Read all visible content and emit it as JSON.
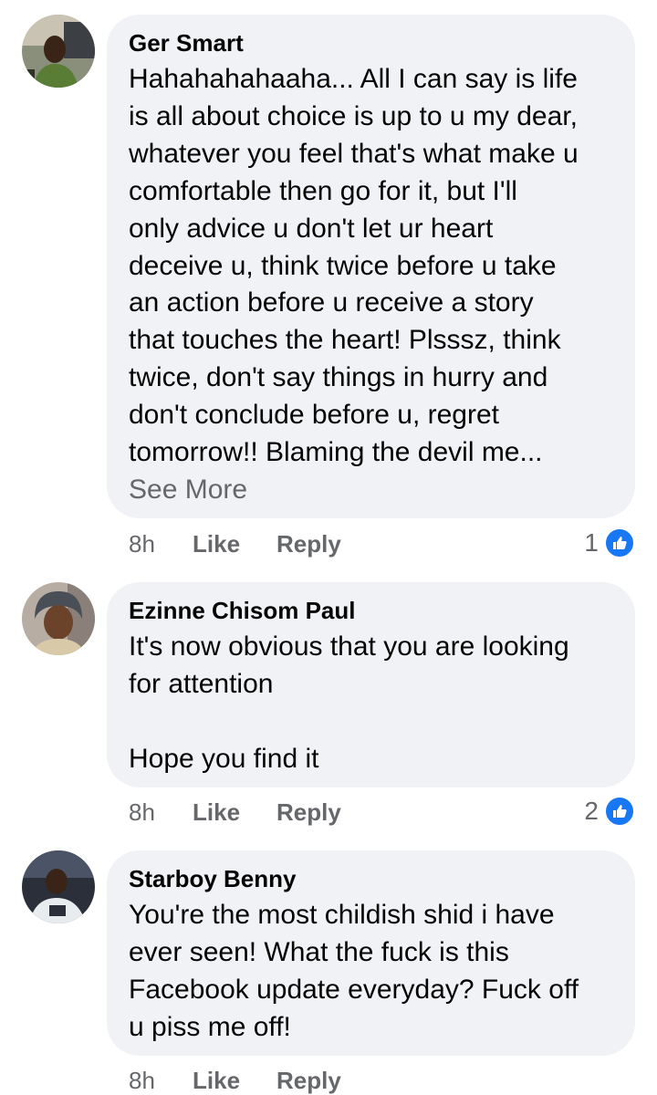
{
  "comments": [
    {
      "author": "Ger Smart",
      "text": "Hahahahahaaha...  All I can say is life\nis all about choice is up to u my dear,\nwhatever you feel that's what make u\ncomfortable then go for it,  but I'll\nonly advice u don't let ur heart\ndeceive u, think twice before u take\nan action before u receive a story\nthat touches the heart!  Plsssz, think\ntwice, don't say things in hurry and\ndon't conclude before u, regret\ntomorrow!!  Blaming the devil me...",
      "see_more": "See More",
      "time": "8h",
      "like": "Like",
      "reply": "Reply",
      "reaction_count": "1",
      "avatar_icon": "profile-photo-icon"
    },
    {
      "author": "Ezinne Chisom Paul",
      "text": "It's now obvious that you are looking\nfor attention\n\nHope you find it",
      "time": "8h",
      "like": "Like",
      "reply": "Reply",
      "reaction_count": "2",
      "avatar_icon": "profile-photo-icon"
    },
    {
      "author": "Starboy Benny",
      "text": "You're the most childish shid i have\never seen! What the fuck is this\nFacebook update everyday? Fuck off\nu piss me off!",
      "time": "8h",
      "like": "Like",
      "reply": "Reply",
      "avatar_icon": "profile-photo-icon"
    }
  ],
  "colors": {
    "bubble": "#f0f2f5",
    "meta_text": "#65676b",
    "like_blue": "#1877f2"
  }
}
